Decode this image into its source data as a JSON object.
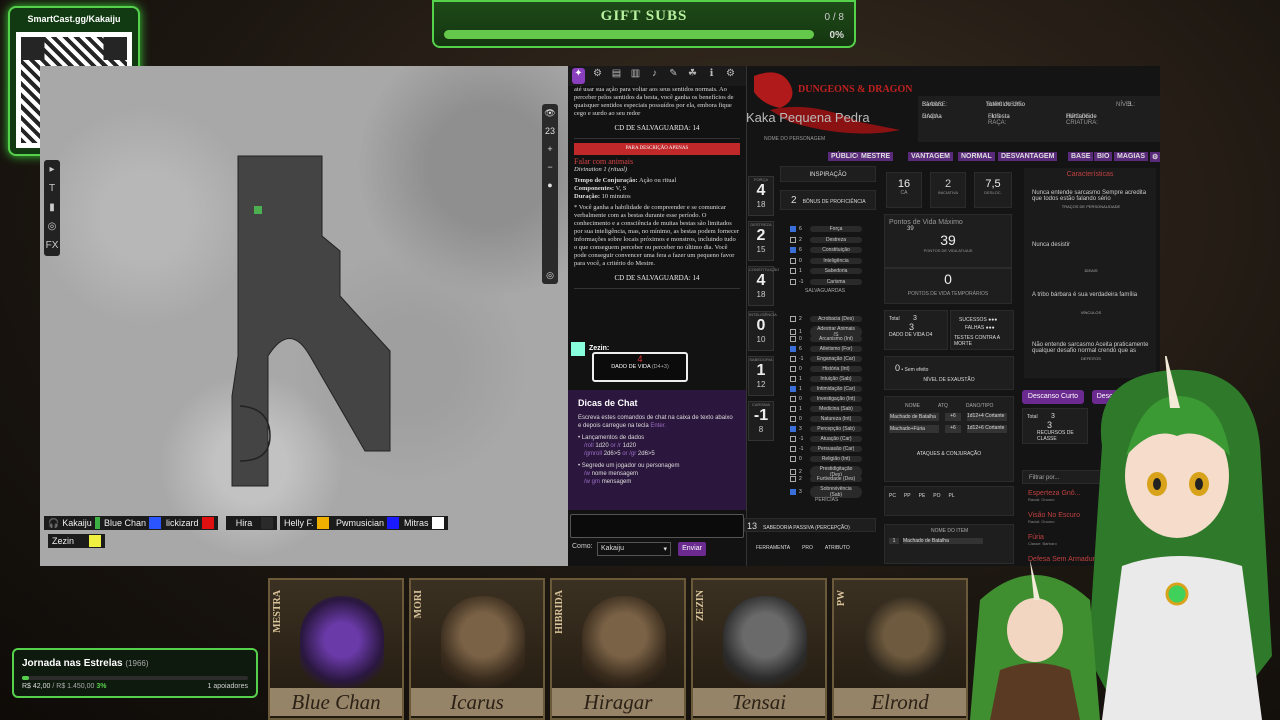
{
  "overlay": {
    "qr_url": "SmartCast.gg/Kakaiju",
    "gift_subs": {
      "title": "GIFT SUBS",
      "count": "0 / 8",
      "percent": "0%"
    },
    "goal": {
      "title": "Jornada nas Estrelas",
      "code": "(1966)",
      "amount": "R$ 42,00",
      "target": "/ R$ 1.450,00",
      "percent": "3%",
      "progress": 0.03,
      "supporters": "1 apoiadores"
    },
    "cards": [
      {
        "side": "MESTRA",
        "name": "Blue Chan"
      },
      {
        "side": "MORI",
        "name": "Icarus"
      },
      {
        "side": "HIBRIDA",
        "name": "Hiragar"
      },
      {
        "side": "ZEZIN",
        "name": "Tensai"
      },
      {
        "side": "PW",
        "name": "Elrond"
      }
    ]
  },
  "map": {
    "toolbar": [
      "▸",
      "T",
      "▮",
      "◎",
      "FX",
      "⚔"
    ],
    "zoom_value": "23",
    "players": [
      {
        "name": "Kakaiju",
        "color": "#3cb043"
      },
      {
        "name": "Blue Chan",
        "color": "#2b55ff"
      },
      {
        "name": "lickizard",
        "color": "#e01010"
      },
      {
        "name": "Hira",
        "color": "#2a2a2a"
      },
      {
        "name": "Helly F.",
        "color": "#f0b000"
      },
      {
        "name": "Pwmusician",
        "color": "#1a1aff"
      },
      {
        "name": "Mitras",
        "color": "#ffffff"
      },
      {
        "name": "Zezin",
        "color": "#f0f040"
      }
    ]
  },
  "spell": {
    "tabs": [
      "✦",
      "⚙",
      "▤",
      "▥",
      "♪",
      "✎",
      "☘",
      "ℹ",
      "⚙"
    ],
    "intro": "até usar sua ação para voltar aos seus sentidos normais. Ao perceber pelos sentidos da besta, você ganha os benefícios de quaisquer sentidos especiais possuídos por ela, embora fique cego e surdo ao seu redor",
    "save1": "CD DE SALVAGUARDA: 14",
    "tag": "PARA DESCRIÇÃO APENAS",
    "name": "Falar com animais",
    "school": "Divination 1 (ritual)",
    "casting_label": "Tempo de Conjuração:",
    "casting": "Ação ou ritual",
    "components_label": "Componentes:",
    "components": "V, S",
    "duration_label": "Duração:",
    "duration": "10 minutos",
    "desc": "* Você ganha a habilidade de compreender e se comunicar verbalmente com as bestas durante esse período. O conhecimento e a consciência de muitas bestas são limitados por sua inteligência, mas, no mínimo, as bestas podem fornecer informações sobre locais próximos e monstros, incluindo tudo o que conseguem perceber ou perceber no último dia. Você pode conseguir convencer uma fera a fazer um pequeno favor para você, a critério do Mestre.",
    "save2": "CD DE SALVAGUARDA: 14"
  },
  "chat": {
    "speaker": "Zezin:",
    "roll_value": "4",
    "roll_label": "DADO DE VIDA",
    "roll_formula": "(D4+3)",
    "tips_title": "Dicas de Chat",
    "tips_intro": "Escreva estes comandos de chat na caixa de texto abaixo e depois carregue na tecla",
    "tips_key": "Enter.",
    "tips_dice": "Lançamentos de dados",
    "tips_d1a": "/roll",
    "tips_d1b": "1d20",
    "tips_d1c": "or",
    "tips_d1d": "/r",
    "tips_d1e": "1d20",
    "tips_d2a": "/gmroll",
    "tips_d2b": "2d6>5",
    "tips_d2c": "or",
    "tips_d2d": "/gr",
    "tips_d2e": "2d6>5",
    "tips_whisper": "Segrede um jogador ou personagem",
    "tips_w1a": "/w",
    "tips_w1b": "nome mensagem",
    "tips_w2a": "/w gm",
    "tips_w2b": "mensagem",
    "as_label": "Como:",
    "as_value": "Kakaiju",
    "send": "Enviar"
  },
  "sheet": {
    "brand": "DUNGEONS & DRAGONS",
    "char_name": "Kaka Pequena Pedra",
    "char_label": "NOME DO PERSONAGEM",
    "class_label": "CLASSE:",
    "class": "Bárbaro",
    "subclass_label": "SUBCLASSE:",
    "subclass": "Totem do Urso",
    "level_label": "NÍVEL:",
    "level": "3",
    "race_label": "RAÇA:",
    "race": "Gnoma",
    "subrace_label": "SUB-RAÇA:",
    "subrace": "Floresta",
    "type_label": "TIPO DE CRIATURA:",
    "type": "Humanoide",
    "nav": [
      "PÚBLICO",
      "MESTRE",
      "VANTAGEM",
      "NORMAL",
      "DESVANTAGEM",
      "BASE",
      "BIO",
      "MAGIAS"
    ],
    "attrs": [
      {
        "label": "FORÇA",
        "value": "4",
        "mod": "18"
      },
      {
        "label": "DESTREZA",
        "value": "2",
        "mod": "15"
      },
      {
        "label": "CONSTITUIÇÃO",
        "value": "4",
        "mod": "18"
      },
      {
        "label": "INTELIGÊNCIA",
        "value": "0",
        "mod": "10"
      },
      {
        "label": "SABEDORIA",
        "value": "1",
        "mod": "12"
      },
      {
        "label": "CARISMA",
        "value": "-1",
        "mod": "8"
      }
    ],
    "inspiration": "INSPIRAÇÃO",
    "prof_value": "2",
    "prof_label": "BÔNUS DE PROFICIÊNCIA",
    "saves": [
      {
        "v": "6",
        "n": "Força",
        "on": true
      },
      {
        "v": "2",
        "n": "Destreza",
        "on": false
      },
      {
        "v": "6",
        "n": "Constituição",
        "on": true
      },
      {
        "v": "0",
        "n": "Inteligência",
        "on": false
      },
      {
        "v": "1",
        "n": "Sabedoria",
        "on": false
      },
      {
        "v": "-1",
        "n": "Carisma",
        "on": false
      }
    ],
    "saves_label": "SALVAGUARDAS",
    "skills": [
      {
        "v": "2",
        "n": "Acrobacia (Des)",
        "on": false
      },
      {
        "v": "1",
        "n": "Adestrar Animais (S",
        "on": false
      },
      {
        "v": "0",
        "n": "Arcanismo (Int)",
        "on": false
      },
      {
        "v": "6",
        "n": "Atletismo (For)",
        "on": true
      },
      {
        "v": "-1",
        "n": "Enganação (Car)",
        "on": false
      },
      {
        "v": "0",
        "n": "História (Int)",
        "on": false
      },
      {
        "v": "1",
        "n": "Intuição (Sab)",
        "on": false
      },
      {
        "v": "1",
        "n": "Intimidação (Car)",
        "on": true
      },
      {
        "v": "0",
        "n": "Investigação (Int)",
        "on": false
      },
      {
        "v": "1",
        "n": "Medicina (Sab)",
        "on": false
      },
      {
        "v": "0",
        "n": "Natureza (Int)",
        "on": false
      },
      {
        "v": "3",
        "n": "Percepção (Sab)",
        "on": true
      },
      {
        "v": "-1",
        "n": "Atuação (Car)",
        "on": false
      },
      {
        "v": "-1",
        "n": "Persuasão (Car)",
        "on": false
      },
      {
        "v": "0",
        "n": "Religião (Int)",
        "on": false
      },
      {
        "v": "2",
        "n": "Prestidigitação (Des)",
        "on": false
      },
      {
        "v": "2",
        "n": "Furtividade (Des)",
        "on": false
      },
      {
        "v": "3",
        "n": "Sobrevivência (Sab)",
        "on": true
      }
    ],
    "skills_label": "PERÍCIAS",
    "passive_value": "13",
    "passive_label": "SABEDORIA PASSIVA (PERCEPÇÃO)",
    "ca_value": "16",
    "ca_label": "CA",
    "init_value": "2",
    "init_label": "INICIATIVA",
    "speed_value": "7,5",
    "speed_label": "DESLOC.",
    "hpmax_label": "Pontos de Vida Máximo",
    "hpmax_value": "39",
    "hp_value": "39",
    "hp_label": "PONTOS DE VIDA ATUAIS",
    "thp_value": "0",
    "thp_label": "PONTOS DE VIDA TEMPORÁRIOS",
    "hd_total_label": "Total",
    "hd_total": "3",
    "hd_value": "3",
    "hd_label": "DADO DE VIDA",
    "hd_die": "D4",
    "death_success": "SUCESSOS",
    "death_fail": "FALHAS",
    "death_label": "TESTES CONTRA A MORTE",
    "exh_value": "0",
    "exh_note": "• Sem efeito",
    "exh_label": "NÍVEL DE EXAUSTÃO",
    "attacks_headers": [
      "NOME",
      "ATQ",
      "DANO/TIPO"
    ],
    "attacks": [
      {
        "name": "Machado de Batalha",
        "atk": "+6",
        "dmg": "1d12+4 Cortante"
      },
      {
        "name": "Machado+Fúria",
        "atk": "+6",
        "dmg": "1d12+6 Cortante"
      }
    ],
    "attacks_label": "ATAQUES & CONJURAÇÃO",
    "coins": [
      "PC",
      "PP",
      "PE",
      "PO",
      "PL"
    ],
    "eq_header": "NOME DO ITEM",
    "eq_item_qty": "1",
    "eq_item": "Machado de Batalha",
    "tools_headers": [
      "FERRAMENTA",
      "PRO",
      "ATRIBUTO"
    ],
    "traits_title": "Características",
    "traits": [
      {
        "text": "Nunca entende sarcasmo Sempre acredita que todos estão falando sério",
        "head": "TRAÇOS DE PERSONALIDADE"
      },
      {
        "text": "Nunca desistir",
        "head": "IDEAIS"
      },
      {
        "text": "A tribo bárbara é sua verdadeira família",
        "head": "VÍNCULOS"
      },
      {
        "text": "Não entende sarcasmo Aceita praticamente qualquer desafio normal crendo que as",
        "head": "DEFEITOS"
      }
    ],
    "short_rest": "Descanso Curto",
    "long_rest": "Descanso Longo",
    "rd_total_label": "Total",
    "rd_total": "3",
    "rd_value": "3",
    "rd_label": "RECURSOS DE CLASSE",
    "filter": "Filtrar por...",
    "features": [
      {
        "name": "Esperteza Gnô...",
        "sub": "Racial: Gnomo"
      },
      {
        "name": "Visão No Escuro",
        "sub": "Racial: Gnomo"
      },
      {
        "name": "Fúria",
        "sub": "Classe: Bárbaro"
      },
      {
        "name": "Defesa Sem Armadura",
        "sub": ""
      }
    ]
  }
}
